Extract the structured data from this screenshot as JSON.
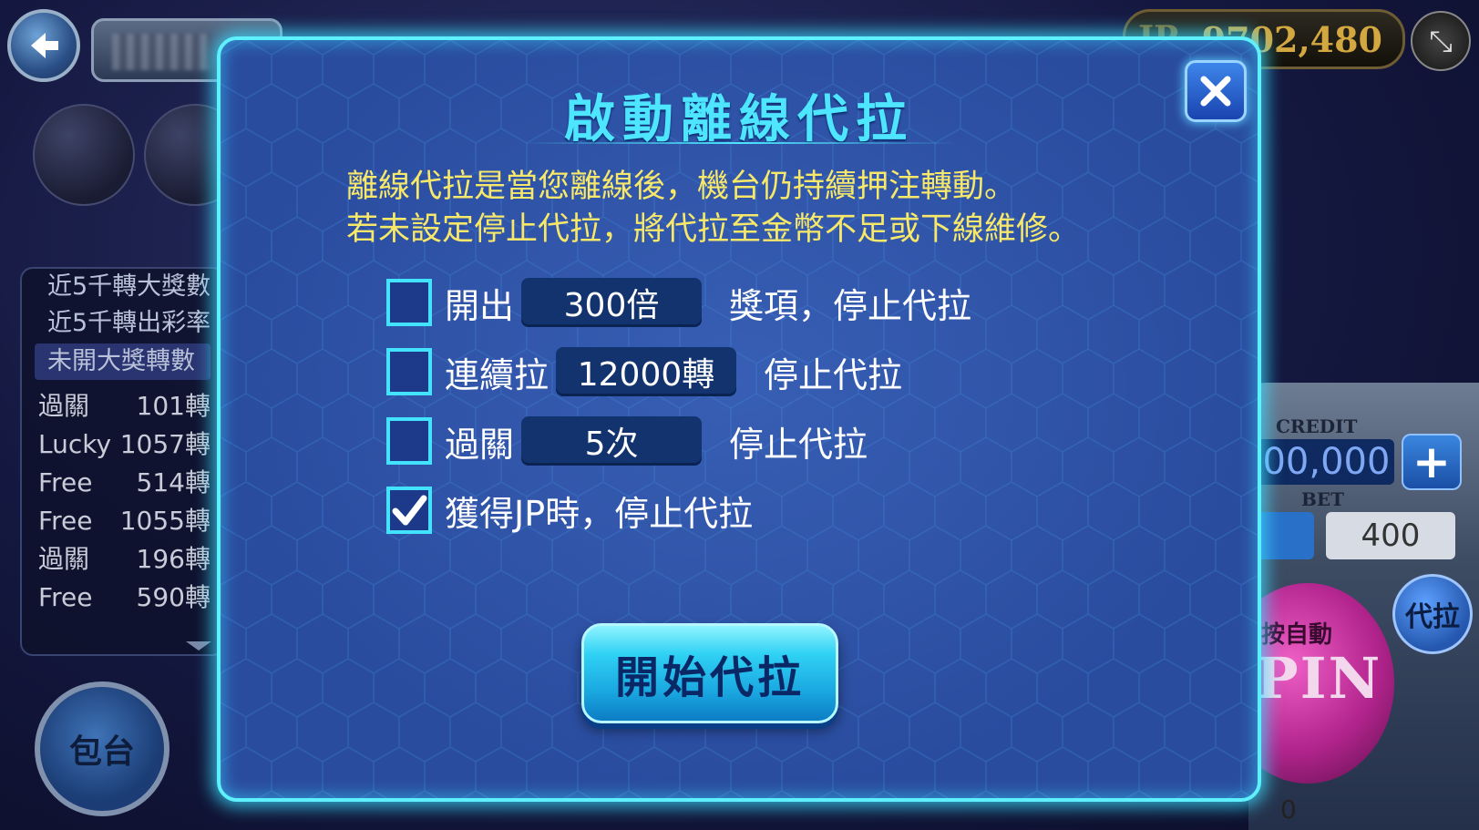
{
  "background": {
    "jackpot_label": "JP",
    "jackpot_value": "9702,480",
    "stats": {
      "headers": [
        "近5千轉大獎數",
        "近5千轉出彩率",
        "未開大獎轉數"
      ],
      "rows": [
        {
          "name": "過關",
          "value": "101轉"
        },
        {
          "name": "Lucky",
          "value": "1057轉"
        },
        {
          "name": "Free",
          "value": "514轉"
        },
        {
          "name": "Free",
          "value": "1055轉"
        },
        {
          "name": "過關",
          "value": "196轉"
        },
        {
          "name": "Free",
          "value": "590轉"
        }
      ]
    },
    "package_button": "包台",
    "credit_label": "CREDIT",
    "credit_value": "000,000",
    "bet_label": "BET",
    "bet_value": "400",
    "auto_button": "代拉",
    "spin_sub": "按自動",
    "spin_text": "PIN",
    "bottom_value": "0"
  },
  "modal": {
    "title": "啟動離線代拉",
    "desc_line1": "離線代拉是當您離線後，機台仍持續押注轉動。",
    "desc_line2": "若未設定停止代拉，將代拉至金幣不足或下線維修。",
    "options": [
      {
        "checked": false,
        "label": "開出",
        "field": "300倍",
        "suffix": "獎項，停止代拉"
      },
      {
        "checked": false,
        "label": "連續拉",
        "field": "12000轉",
        "suffix": "停止代拉"
      },
      {
        "checked": false,
        "label": "過關",
        "field": "5次",
        "suffix": "停止代拉"
      },
      {
        "checked": true,
        "label": "獲得JP時，停止代拉"
      }
    ],
    "start_button": "開始代拉"
  },
  "colors": {
    "modal_border": "#5ff0ff",
    "title": "#4ee6ff",
    "description": "#f7e86a",
    "button": "#1aa7e0"
  },
  "icons": [
    "back-arrow-icon",
    "close-icon",
    "checkmark-icon",
    "resize-icon",
    "plus-icon"
  ]
}
